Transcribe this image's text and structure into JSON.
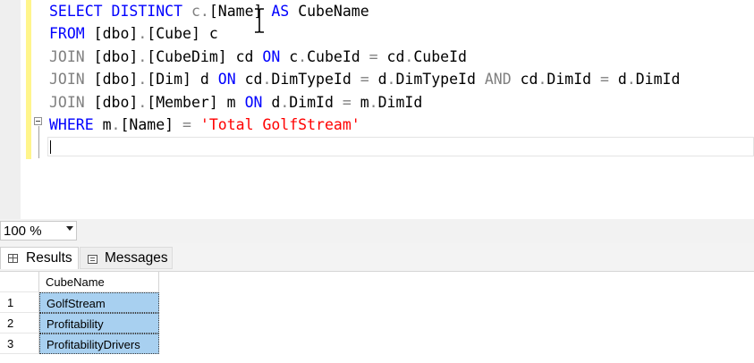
{
  "editor": {
    "lines": [
      [
        {
          "t": "SELECT DISTINCT ",
          "c": "kw"
        },
        {
          "t": "c.",
          "c": "gr"
        },
        {
          "t": "[Name]",
          "c": ""
        },
        {
          "t": " AS ",
          "c": "kw"
        },
        {
          "t": "CubeName",
          "c": ""
        }
      ],
      [
        {
          "t": "FROM ",
          "c": "kw"
        },
        {
          "t": "[dbo]",
          "c": ""
        },
        {
          "t": ".",
          "c": "gr"
        },
        {
          "t": "[Cube] c",
          "c": ""
        }
      ],
      [
        {
          "t": "JOIN ",
          "c": "gr"
        },
        {
          "t": "[dbo]",
          "c": ""
        },
        {
          "t": ".",
          "c": "gr"
        },
        {
          "t": "[CubeDim] cd ",
          "c": ""
        },
        {
          "t": "ON ",
          "c": "kw"
        },
        {
          "t": "c",
          "c": ""
        },
        {
          "t": ".",
          "c": "gr"
        },
        {
          "t": "CubeId ",
          "c": ""
        },
        {
          "t": "= ",
          "c": "gr"
        },
        {
          "t": "cd",
          "c": ""
        },
        {
          "t": ".",
          "c": "gr"
        },
        {
          "t": "CubeId",
          "c": ""
        }
      ],
      [
        {
          "t": "JOIN ",
          "c": "gr"
        },
        {
          "t": "[dbo]",
          "c": ""
        },
        {
          "t": ".",
          "c": "gr"
        },
        {
          "t": "[Dim] d ",
          "c": ""
        },
        {
          "t": "ON ",
          "c": "kw"
        },
        {
          "t": "cd",
          "c": ""
        },
        {
          "t": ".",
          "c": "gr"
        },
        {
          "t": "DimTypeId ",
          "c": ""
        },
        {
          "t": "= ",
          "c": "gr"
        },
        {
          "t": "d",
          "c": ""
        },
        {
          "t": ".",
          "c": "gr"
        },
        {
          "t": "DimTypeId ",
          "c": ""
        },
        {
          "t": "AND ",
          "c": "gr"
        },
        {
          "t": "cd",
          "c": ""
        },
        {
          "t": ".",
          "c": "gr"
        },
        {
          "t": "DimId ",
          "c": ""
        },
        {
          "t": "= ",
          "c": "gr"
        },
        {
          "t": "d",
          "c": ""
        },
        {
          "t": ".",
          "c": "gr"
        },
        {
          "t": "DimId",
          "c": ""
        }
      ],
      [
        {
          "t": "JOIN ",
          "c": "gr"
        },
        {
          "t": "[dbo]",
          "c": ""
        },
        {
          "t": ".",
          "c": "gr"
        },
        {
          "t": "[Member] m ",
          "c": ""
        },
        {
          "t": "ON ",
          "c": "kw"
        },
        {
          "t": "d",
          "c": ""
        },
        {
          "t": ".",
          "c": "gr"
        },
        {
          "t": "DimId ",
          "c": ""
        },
        {
          "t": "= ",
          "c": "gr"
        },
        {
          "t": "m",
          "c": ""
        },
        {
          "t": ".",
          "c": "gr"
        },
        {
          "t": "DimId",
          "c": ""
        }
      ],
      [
        {
          "t": "WHERE ",
          "c": "kw"
        },
        {
          "t": "m",
          "c": ""
        },
        {
          "t": ".",
          "c": "gr"
        },
        {
          "t": "[Name] ",
          "c": ""
        },
        {
          "t": "= ",
          "c": "gr"
        },
        {
          "t": "'Total GolfStream'",
          "c": "str"
        }
      ]
    ]
  },
  "zoom": {
    "value": "100 %"
  },
  "tabs": {
    "results": "Results",
    "messages": "Messages"
  },
  "grid": {
    "column": "CubeName",
    "rows": [
      {
        "n": "1",
        "value": "GolfStream"
      },
      {
        "n": "2",
        "value": "Profitability"
      },
      {
        "n": "3",
        "value": "ProfitabilityDrivers"
      }
    ]
  },
  "colors": {
    "keyword": "#0000ff",
    "operator": "#808080",
    "string": "#ff0000",
    "selection": "#a8d0f0",
    "change_bar": "#fff58c"
  },
  "icons": [
    "ibeam-cursor-icon",
    "collapse-minus-icon",
    "chevron-down-icon",
    "grid-icon",
    "messages-icon"
  ]
}
